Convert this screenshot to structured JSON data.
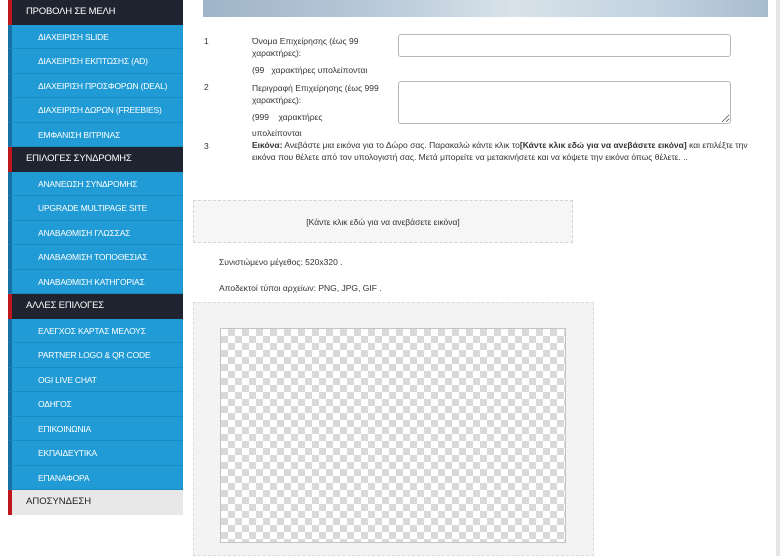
{
  "sidebar": {
    "sections": [
      {
        "title": "ΠΡΟΒΟΛΗ ΣΕ ΜΕΛΗ",
        "items": [
          "ΔΙΑΧΕΙΡΙΣΗ SLIDE",
          "ΔΙΑΧΕΙΡΙΣΗ ΕΚΠΤΩΣΗΣ (AD)",
          "ΔΙΑΧΕΙΡΙΣΗ ΠΡΟΣΦΟΡΩΝ (DEAL)",
          "ΔΙΑΧΕΙΡΙΣΗ ΔΩΡΩΝ (FREEBIES)",
          "ΕΜΦΑΝΙΣΗ ΒΙΤΡΙΝΑΣ"
        ]
      },
      {
        "title": "ΕΠΙΛΟΓΕΣ ΣΥΝΔΡΟΜΗΣ",
        "items": [
          "ΑΝΑΝΕΩΣΗ ΣΥΝΔΡΟΜΗΣ",
          "UPGRADE MULTIPAGE SITE",
          "ΑΝΑΒΑΘΜΙΣΗ ΓΛΩΣΣΑΣ",
          "ΑΝΑΒΑΘΜΙΣΗ ΤΟΠΟΘΕΣΙΑΣ",
          "ΑΝΑΒΑΘΜΙΣΗ ΚΑΤΗΓΟΡΙΑΣ"
        ]
      },
      {
        "title": "ΑΛΛΕΣ ΕΠΙΛΟΓΕΣ",
        "items": [
          "ΕΛΕΓΧΟΣ ΚΑΡΤΑΣ ΜΕΛΟΥΣ",
          "PARTNER LOGO & QR CODE",
          "OGI LIVE CHAT",
          "ΟΔΗΓΟΣ",
          "ΕΠΙΚΟΙΝΩΝΙΑ",
          "ΕΚΠΑΙΔΕΥΤΙΚΑ",
          "ΕΠΑΝΑΦΟΡΑ"
        ]
      }
    ],
    "logout": "ΑΠΟΣΥΝΔΕΣΗ"
  },
  "form": {
    "row1": {
      "number": "1",
      "label": "Όνομα Επιχείρησης (έως 99 χαρακτήρες):",
      "remaining_count": "(99",
      "remaining_text": "χαρακτήρες υπολείπονται",
      "input_value": ""
    },
    "row2": {
      "number": "2",
      "label": "Περιγραφή Επιχείρησης (έως 999 χαρακτήρες):",
      "remaining_count": "(999",
      "remaining_text": "χαρακτήρες",
      "remaining_text2": "υπολείπονται",
      "textarea_value": ""
    },
    "row3": {
      "number": "3",
      "label_strong": "Εικόνα:",
      "text_before": " Ανεβάστε μια εικόνα για το Δώρο σας. Παρακαλώ κάντε κλικ το",
      "link_text": "[Κάντε κλικ εδώ για να ανεβάσετε εικόνα]",
      "text_after": " και επιλέξτε την εικόνα που θέλετε από τον υπολογιστή σας. Μετά μπορείτε να μετακινήσετε και να κόψετε την εικόνα όπως θέλετε. .."
    },
    "upload_button": "[Κάντε κλικ εδώ για να ανεβάσετε εικόνα]",
    "recommended_size": "Συνιστώμενο μέγεθος: 520x320 .",
    "accepted_types": "Αποδεκτοί τύποι αρχείων: PNG, JPG, GIF ."
  },
  "colors": {
    "sidebar_section_bg": "#1f2430",
    "sidebar_item_bg": "#219bd6",
    "accent_red": "#c0171c"
  }
}
